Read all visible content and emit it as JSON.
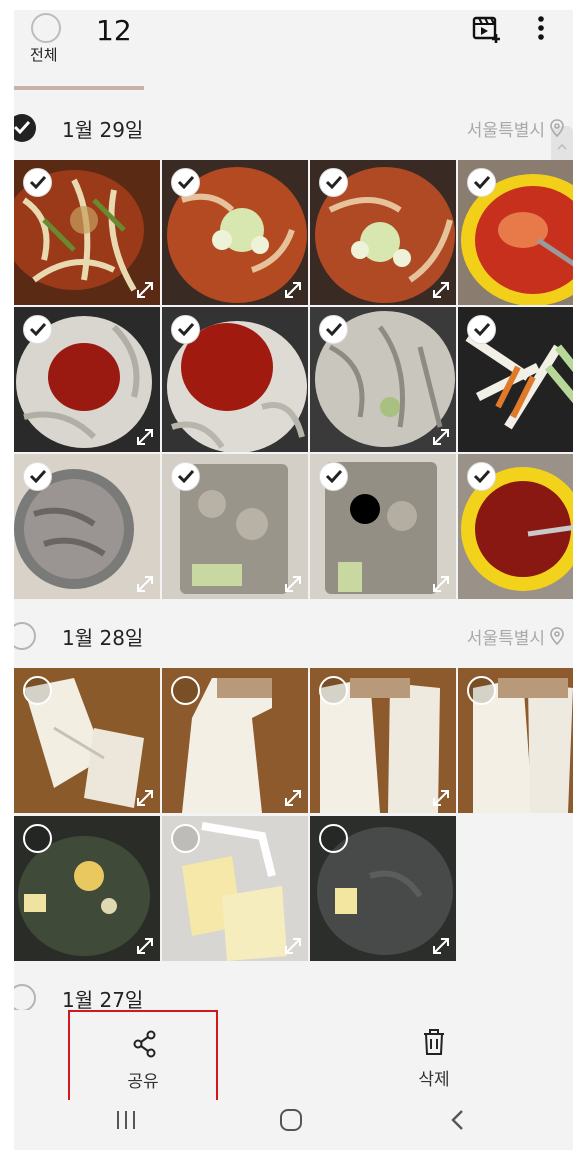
{
  "header": {
    "select_all_label": "전체",
    "selected_count": "12",
    "icons": [
      "create-movie-icon",
      "more-options-icon"
    ]
  },
  "groups": [
    {
      "date": "1월 29일",
      "location": "서울특별시",
      "all_selected": true,
      "photos": [
        {
          "subject": "stir-fried spicy squid",
          "selected": true
        },
        {
          "subject": "spicy stew in pan",
          "selected": true
        },
        {
          "subject": "spicy stew in pan",
          "selected": true
        },
        {
          "subject": "red pepper sauce bowl",
          "selected": true
        },
        {
          "subject": "mushrooms with sauce",
          "selected": true
        },
        {
          "subject": "mushrooms with sauce",
          "selected": true
        },
        {
          "subject": "sliced mushrooms in pan",
          "selected": true
        },
        {
          "subject": "sliced vegetables",
          "selected": true
        },
        {
          "subject": "mushrooms in steel bowl",
          "selected": true
        },
        {
          "subject": "mushroom package",
          "selected": true
        },
        {
          "subject": "mushroom package",
          "selected": true
        },
        {
          "subject": "red sauce in yellow bowl",
          "selected": true
        }
      ]
    },
    {
      "date": "1월 28일",
      "location": "서울특별시",
      "all_selected": false,
      "photos": [
        {
          "subject": "sliced king oyster mushroom",
          "selected": false
        },
        {
          "subject": "king oyster mushroom slices",
          "selected": false
        },
        {
          "subject": "king oyster mushroom slices",
          "selected": false
        },
        {
          "subject": "king oyster mushroom slices",
          "selected": false
        },
        {
          "subject": "butter and garlic in pan",
          "selected": false
        },
        {
          "subject": "butter block",
          "selected": false
        },
        {
          "subject": "butter in pan",
          "selected": false
        }
      ]
    },
    {
      "date": "1월 27일",
      "all_selected": false
    }
  ],
  "bottom_actions": {
    "share_label": "공유",
    "delete_label": "삭제"
  },
  "nav": [
    "recent-apps-icon",
    "home-icon",
    "back-icon"
  ],
  "colors": {
    "highlight_border": "#d0181e",
    "background": "#f3f3f3"
  }
}
